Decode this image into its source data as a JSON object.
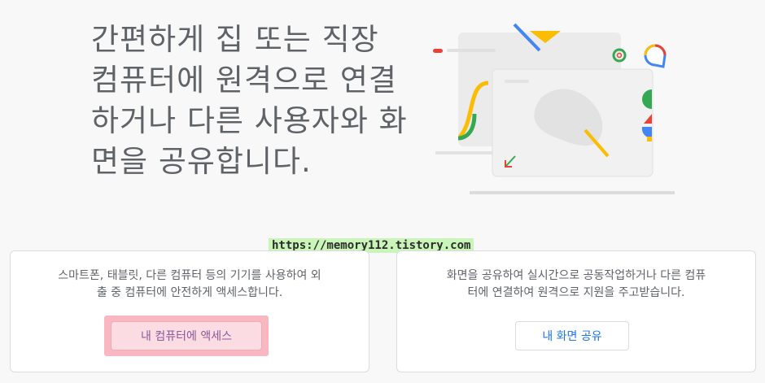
{
  "hero": {
    "title_lines": [
      "간편하게 집 또는 직장",
      "컴퓨터에 원격으로 연결",
      "하거나 다른 사용자와 화",
      "면을 공유합니다."
    ]
  },
  "watermark": {
    "text": "https://memory112.tistory.com"
  },
  "cards": {
    "access": {
      "desc_line1": "스마트폰, 태블릿, 다른 컴퓨터 등의 기기를 사용하여 외",
      "desc_line2": "출 중 컴퓨터에 안전하게 액세스합니다.",
      "button_label": "내 컴퓨터에 액세스"
    },
    "share": {
      "desc_line1": "화면을 공유하여 실시간으로 공동작업하거나 다른 컴퓨",
      "desc_line2": "터에 연결하여 원격으로 지원을 주고받습니다.",
      "button_label": "내 화면 공유"
    }
  },
  "colors": {
    "blue": "#4285f4",
    "red": "#ea4335",
    "yellow": "#fbbc04",
    "green": "#34a853",
    "text": "#5f6368",
    "link": "#1a73e8"
  }
}
